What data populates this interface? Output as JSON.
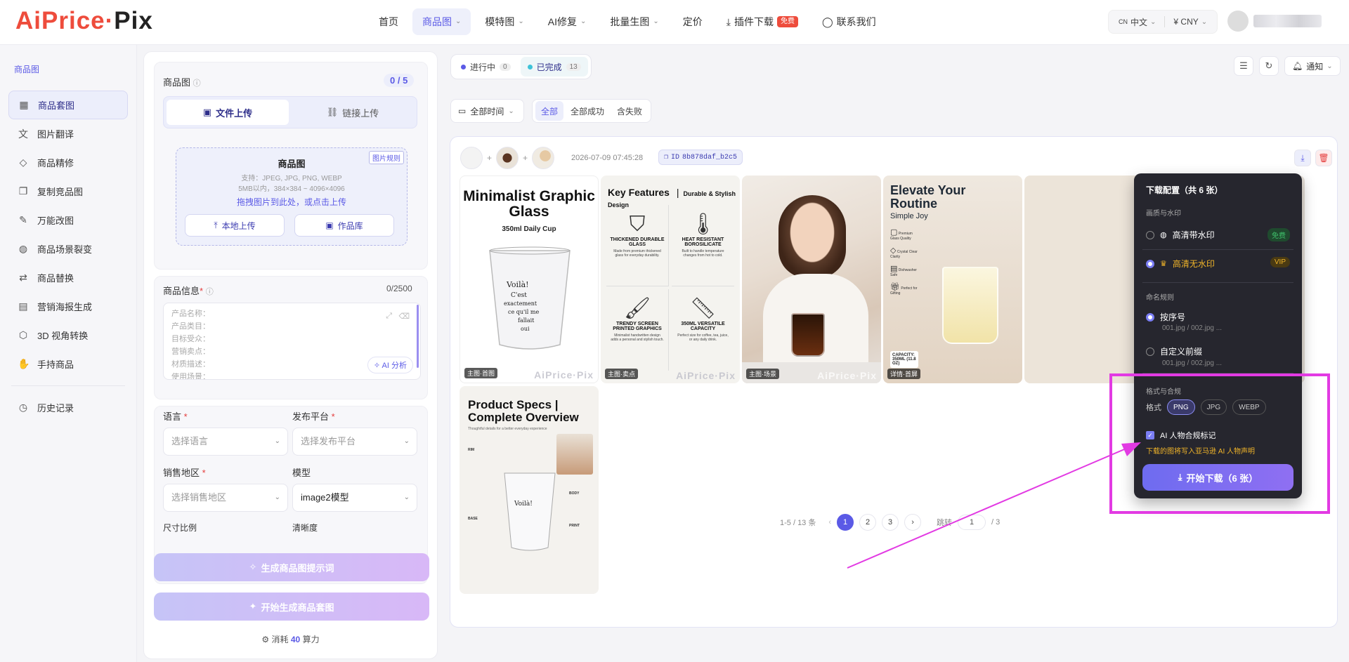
{
  "logo": {
    "part1": "AiPrice",
    "sep": "·",
    "part2": "Pix"
  },
  "nav": [
    {
      "label": "首页",
      "dropdown": false
    },
    {
      "label": "商品图",
      "dropdown": true,
      "active": true
    },
    {
      "label": "模特图",
      "dropdown": true
    },
    {
      "label": "AI修复",
      "dropdown": true
    },
    {
      "label": "批量生图",
      "dropdown": true
    },
    {
      "label": "定价",
      "dropdown": false
    },
    {
      "label": "插件下载",
      "badge": "免费",
      "icon": "download-icon"
    },
    {
      "label": "联系我们",
      "icon": "chat-icon"
    }
  ],
  "header": {
    "lang": "中文",
    "lang_prefix": "CN",
    "currency": "¥ CNY"
  },
  "sidebar": {
    "title": "商品图",
    "items": [
      {
        "label": "商品套图",
        "icon": "grid-icon",
        "active": true
      },
      {
        "label": "图片翻译",
        "icon": "translate-icon"
      },
      {
        "label": "商品精修",
        "icon": "diamond-icon"
      },
      {
        "label": "复制竞品图",
        "icon": "copy-icon"
      },
      {
        "label": "万能改图",
        "icon": "magic-wand-icon"
      },
      {
        "label": "商品场景裂变",
        "icon": "drops-icon"
      },
      {
        "label": "商品替换",
        "icon": "swap-icon"
      },
      {
        "label": "营销海报生成",
        "icon": "poster-icon"
      },
      {
        "label": "3D 视角转换",
        "icon": "cube-icon"
      },
      {
        "label": "手持商品",
        "icon": "hand-icon"
      }
    ],
    "history": "历史记录"
  },
  "panel": {
    "product_image_label": "商品图",
    "counter": "0 / 5",
    "tab_file": "文件上传",
    "tab_link": "链接上传",
    "dz_title": "商品图",
    "dz_formats": "支持：JPEG, JPG, PNG, WEBP",
    "dz_size": "5MB以内，384×384 ~ 4096×4096",
    "dz_link": "拖拽图片到此处，或点击上传",
    "dz_tag": "图片规则",
    "btn_local": "本地上传",
    "btn_gallery": "作品库",
    "info_label": "商品信息",
    "info_counter": "0/2500",
    "info_lines": [
      "产品名称：",
      "产品类目：",
      "目标受众：",
      "营销卖点：",
      "材质描述：",
      "使用场景："
    ],
    "ai_analyze": "AI 分析",
    "lang_label": "语言",
    "lang_placeholder": "选择语言",
    "platform_label": "发布平台",
    "platform_placeholder": "选择发布平台",
    "region_label": "销售地区",
    "region_placeholder": "选择销售地区",
    "model_label": "模型",
    "model_value": "image2模型",
    "ratio_label": "尺寸比例",
    "clarity_label": "清晰度",
    "btn_prompt": "生成商品图提示词",
    "btn_generate": "开始生成商品套图",
    "cost_prefix": "消耗",
    "cost_value": "40",
    "cost_unit": "算力"
  },
  "main": {
    "status_tabs": [
      {
        "label": "进行中",
        "count": "0",
        "color": "#5b5ae6"
      },
      {
        "label": "已完成",
        "count": "13",
        "color": "#3ec3d8",
        "active": true
      }
    ],
    "notify": "通知",
    "time_filter": "全部时间",
    "result_filters": [
      {
        "label": "全部",
        "active": true
      },
      {
        "label": "全部成功"
      },
      {
        "label": "含失败"
      }
    ],
    "card": {
      "date": "2026-07-09 07:45:28",
      "id_prefix": "ID",
      "id": "8b878daf_b2c5",
      "images": [
        {
          "tag": "主图·首图",
          "title": "Minimalist Graphic Glass",
          "subtitle": "350ml Daily Cup"
        },
        {
          "tag": "主图·卖点",
          "title": "Key Features",
          "subtitle": "Durable & Stylish Design",
          "features": [
            {
              "h": "THICKENED DURABLE GLASS",
              "d": "Made from premium thickened glass for everyday durability."
            },
            {
              "h": "HEAT RESISTANT BOROSILICATE",
              "d": "Built to handle temperature changes from hot to cold."
            },
            {
              "h": "TRENDY SCREEN PRINTED GRAPHICS",
              "d": "Minimalist handwritten design adds a personal and stylish touch."
            },
            {
              "h": "350ML VERSATILE CAPACITY",
              "d": "Perfect size for coffee, tea, juice, or any daily drink."
            }
          ]
        },
        {
          "tag": "主图·场景"
        },
        {
          "tag": "详情·首屏",
          "title": "Elevate Your Routine",
          "subtitle": "Simple Joy",
          "features": [
            "Premium Glass Quality",
            "Crystal Clear Clarity",
            "Dishwasher Safe",
            "Perfect for Gifting"
          ],
          "capacity": "CAPACITY: 350ML (11.8 OZ)"
        },
        {
          "title": "Product Specs | Complete Overview",
          "subtitle": "Thoughtful details for a better everyday experience",
          "labels": [
            "RIM",
            "BODY",
            "BASE",
            "PRINT"
          ]
        }
      ],
      "watermark": "AiPrice·Pix"
    },
    "glass_print": [
      "Voilà!",
      "C'est",
      "exactement",
      "ce qu'il me",
      "fallait",
      "oui"
    ],
    "pagination": {
      "range": "1-5 / 13 条",
      "pages": [
        "1",
        "2",
        "3"
      ],
      "current": "1",
      "jump_label": "跳转",
      "jump_value": "1",
      "total": "/ 3"
    }
  },
  "popup": {
    "title": "下载配置（共 6 张）",
    "quality_section": "画质与水印",
    "opt_watermark": "高清带水印",
    "badge_free": "免费",
    "opt_nowatermark": "高清无水印",
    "badge_vip": "VIP",
    "naming_section": "命名规则",
    "opt_seq": "按序号",
    "seq_example": "001.jpg / 002.jpg ...",
    "opt_custom": "自定义前缀",
    "custom_example": "001.jpg / 002.jpg ...",
    "format_section": "格式与合规",
    "format_label": "格式",
    "formats": [
      "PNG",
      "JPG",
      "WEBP"
    ],
    "active_format": "PNG",
    "compliance": "AI 人物合规标记",
    "compliance_note": "下载的图将写入亚马逊 AI 人物声明",
    "download_btn": "开始下载（6 张）"
  },
  "colors": {
    "accent": "#5b5ae6",
    "brand_red": "#ee4c3c",
    "highlight": "#e23ae3",
    "popup_bg": "#26262e",
    "vip": "#f0b429",
    "free": "#3fbf6b"
  }
}
